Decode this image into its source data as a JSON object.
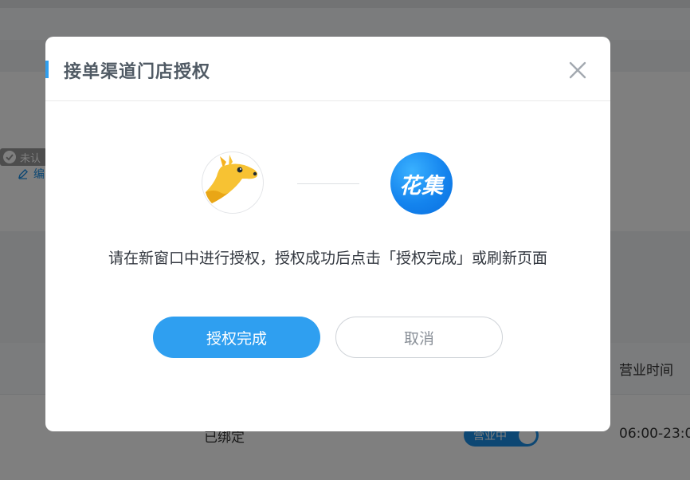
{
  "background": {
    "edit_label": "编",
    "badge_label": "未认",
    "table_header_hours": "营业时间",
    "row_bind_status": "已绑定",
    "row_toggle_label": "营业中",
    "row_hours": "06:00-23:0"
  },
  "modal": {
    "title": "接单渠道门店授权",
    "close_icon": "close-icon",
    "left_logo": "kangaroo-logo",
    "right_logo_text": "花集",
    "instruction": "请在新窗口中进行授权，授权成功后点击「授权完成」或刷新页面",
    "confirm_label": "授权完成",
    "cancel_label": "取消"
  },
  "colors": {
    "accent": "#2f9ff0",
    "title_text": "#505a64",
    "logo_yellow": "#f7c233",
    "logo_blue": "#1484ee"
  }
}
